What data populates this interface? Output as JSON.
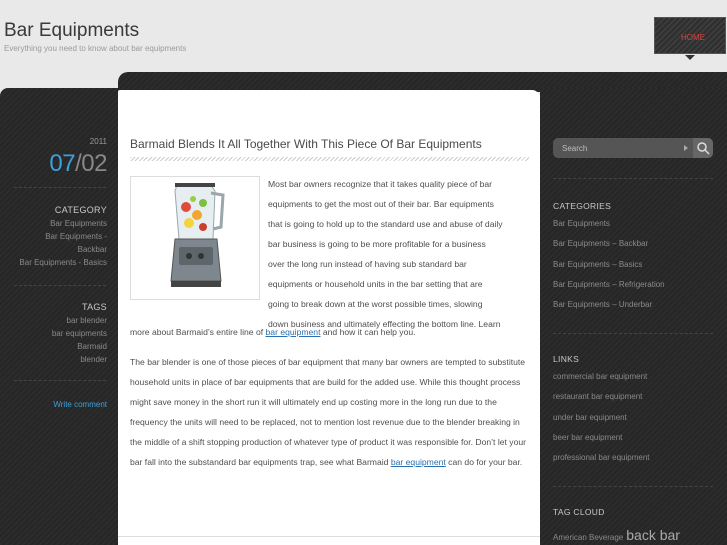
{
  "header": {
    "site_title": "Bar Equipments",
    "site_description": "Everything you need to know about bar equipments",
    "home_label": "HOME"
  },
  "left_sidebar": {
    "year": "2011",
    "month": "07",
    "day": "02",
    "category_heading": "CATEGORY",
    "categories": [
      "Bar Equipments",
      "Bar Equipments -",
      "Backbar",
      "Bar Equipments - Basics"
    ],
    "tags_heading": "TAGS",
    "tags": [
      "bar blender",
      "bar equipments",
      "Barmaid",
      "blender"
    ],
    "write_comment": "Write comment"
  },
  "post": {
    "title": "Barmaid Blends It All Together With This Piece Of Bar Equipments",
    "image_name": "blender-image",
    "p1_lines": [
      "Most bar owners recognize that it takes quality piece of bar",
      "equipments to get the most out of their bar. Bar equipments",
      "that is going to hold up to the standard use and abuse of daily",
      "bar business is going to be more profitable for a business",
      "over the long run instead of having sub standard bar",
      "equipments or household units in the bar setting that are",
      "going to break down at the worst possible times, slowing",
      "down business and ultimately effecting the bottom line. Learn"
    ],
    "p1_tail_before": "more about Barmaid’s entire line of ",
    "p1_link": "bar equipment",
    "p1_tail_after": " and how it can help you.",
    "p2_text": "The bar blender is one of those pieces of bar equipment that many bar owners are tempted to substitute household units in place of bar equipments that are build for the added use. While this thought process might save money in the short run it will ultimately end up costing more in the long run due to the frequency the units will need to be replaced, not to mention lost revenue due to the blender breaking in the middle of a shift stopping production of whatever type of product it was responsible for. Don’t let your bar fall into the substandard bar equipments trap, see what Barmaid ",
    "p2_link": "bar equipment",
    "p2_after": " can do for your bar."
  },
  "right_sidebar": {
    "search_placeholder": "Search",
    "categories_heading": "CATEGORIES",
    "categories": [
      "Bar Equipments",
      "Bar Equipments – Backbar",
      "Bar Equipments – Basics",
      "Bar Equipments – Refrigeration",
      "Bar Equipments – Underbar"
    ],
    "links_heading": "LINKS",
    "links": [
      "commercial bar equipment",
      "restaurant bar equipment",
      "under bar equipment",
      "beer bar equipment",
      "professional bar equipment"
    ],
    "tagcloud_heading": "TAG CLOUD",
    "tagcloud_small": "American Beverage",
    "tagcloud_big": "back bar"
  }
}
